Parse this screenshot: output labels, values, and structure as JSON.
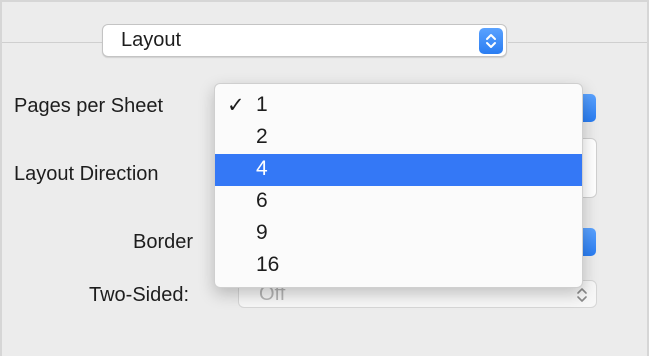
{
  "section_popup": {
    "value": "Layout",
    "icon": "popup-stepper-icon"
  },
  "rows": {
    "pages_per_sheet_label": "Pages per Sheet",
    "layout_direction_label": "Layout Direction",
    "border_label": "Border",
    "two_sided_label": "Two-Sided:",
    "two_sided_value": "Off"
  },
  "menu": {
    "items": [
      {
        "label": "1",
        "checked": true,
        "highlighted": false
      },
      {
        "label": "2",
        "checked": false,
        "highlighted": false
      },
      {
        "label": "4",
        "checked": false,
        "highlighted": true
      },
      {
        "label": "6",
        "checked": false,
        "highlighted": false
      },
      {
        "label": "9",
        "checked": false,
        "highlighted": false
      },
      {
        "label": "16",
        "checked": false,
        "highlighted": false
      }
    ],
    "check_glyph": "✓"
  },
  "colors": {
    "accent": "#3478f6",
    "background": "#ececec"
  }
}
